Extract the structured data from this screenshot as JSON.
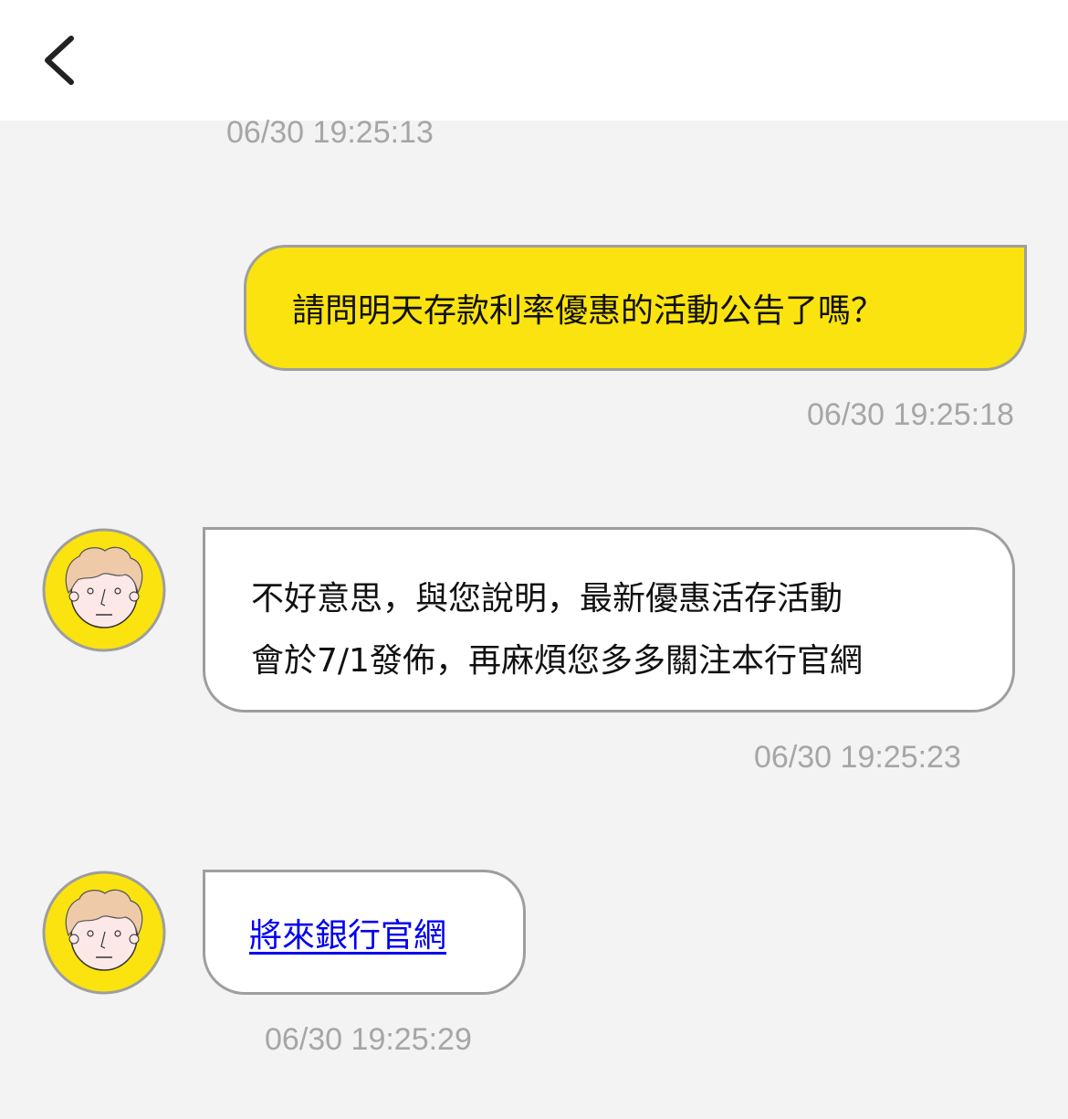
{
  "header": {
    "back_icon": "chevron-left-icon"
  },
  "messages": [
    {
      "type": "timestamp",
      "time": "06/30 19:25:13"
    },
    {
      "type": "user",
      "text": "請問明天存款利率優惠的活動公告了嗎？",
      "time": "06/30 19:25:18"
    },
    {
      "type": "bot",
      "lines": [
        "不好意思，與您說明，最新優惠活存活動",
        "會於7/1發佈，再麻煩您多多關注本行官網"
      ],
      "time": "06/30 19:25:23"
    },
    {
      "type": "bot-link",
      "link_text": "將來銀行官網",
      "time": "06/30 19:25:29"
    }
  ],
  "colors": {
    "user_bubble": "#fbe30f",
    "avatar_bg": "#fbe30f",
    "link": "#0000ee",
    "timestamp": "#a6a6a6"
  }
}
